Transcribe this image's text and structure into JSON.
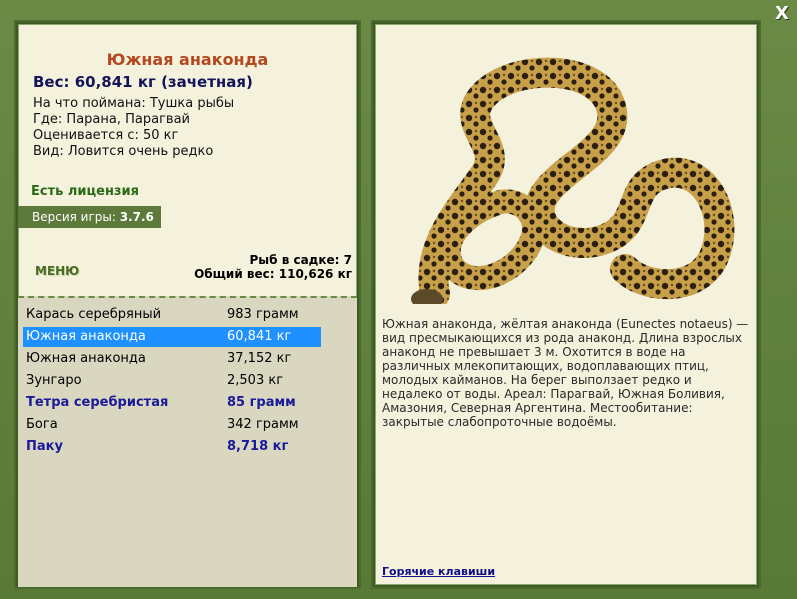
{
  "close": {
    "label": "X"
  },
  "fish": {
    "title": "Южная анаконда",
    "weight_line": "Вес: 60,841 кг (зачетная)",
    "details": [
      "На что поймана: Тушка рыбы",
      "Где: Парана, Парагвай",
      "Оценивается с: 50 кг",
      "Вид: Ловится очень редко"
    ]
  },
  "license": "Есть лицензия",
  "version": {
    "label": "Версия игры:",
    "value": "3.7.6"
  },
  "menu_label": "МЕНЮ",
  "cage": {
    "count_line": "Рыб в садке: 7",
    "total_line": "Общий вес: 110,626 кг"
  },
  "catch_list": [
    {
      "name": "Карась серебряный",
      "weight": "983 грамм",
      "style": "normal"
    },
    {
      "name": "Южная анаконда",
      "weight": "60,841 кг",
      "style": "selected"
    },
    {
      "name": "Южная анаконда",
      "weight": "37,152 кг",
      "style": "normal"
    },
    {
      "name": "Зунгаро",
      "weight": "2,503 кг",
      "style": "normal"
    },
    {
      "name": "Тетра серебристая",
      "weight": "85 грамм",
      "style": "blue"
    },
    {
      "name": "Бога",
      "weight": "342 грамм",
      "style": "normal"
    },
    {
      "name": "Паку",
      "weight": "8,718 кг",
      "style": "blue"
    }
  ],
  "description": "Южная анаконда, жёлтая анаконда (Eunectes notaeus) — вид пресмыкающихся из рода анаконд. Длина взрослых анаконд не превышает 3 м. Охотится в воде на различных млекопитающих, водоплавающих птиц, молодых кайманов. На берег выползает редко и недалеко от воды. Ареал: Парагвай, Южная Боливия, Амазония, Северная Аргентина. Местообитание: закрытые слабопроточные водоёмы.",
  "hotkeys_label": "Горячие клавиши",
  "colors": {
    "selected_row": "#1e90ff",
    "title": "#b4481e",
    "panel_bg": "#f4f1dd",
    "frame": "#5a7a3a"
  }
}
